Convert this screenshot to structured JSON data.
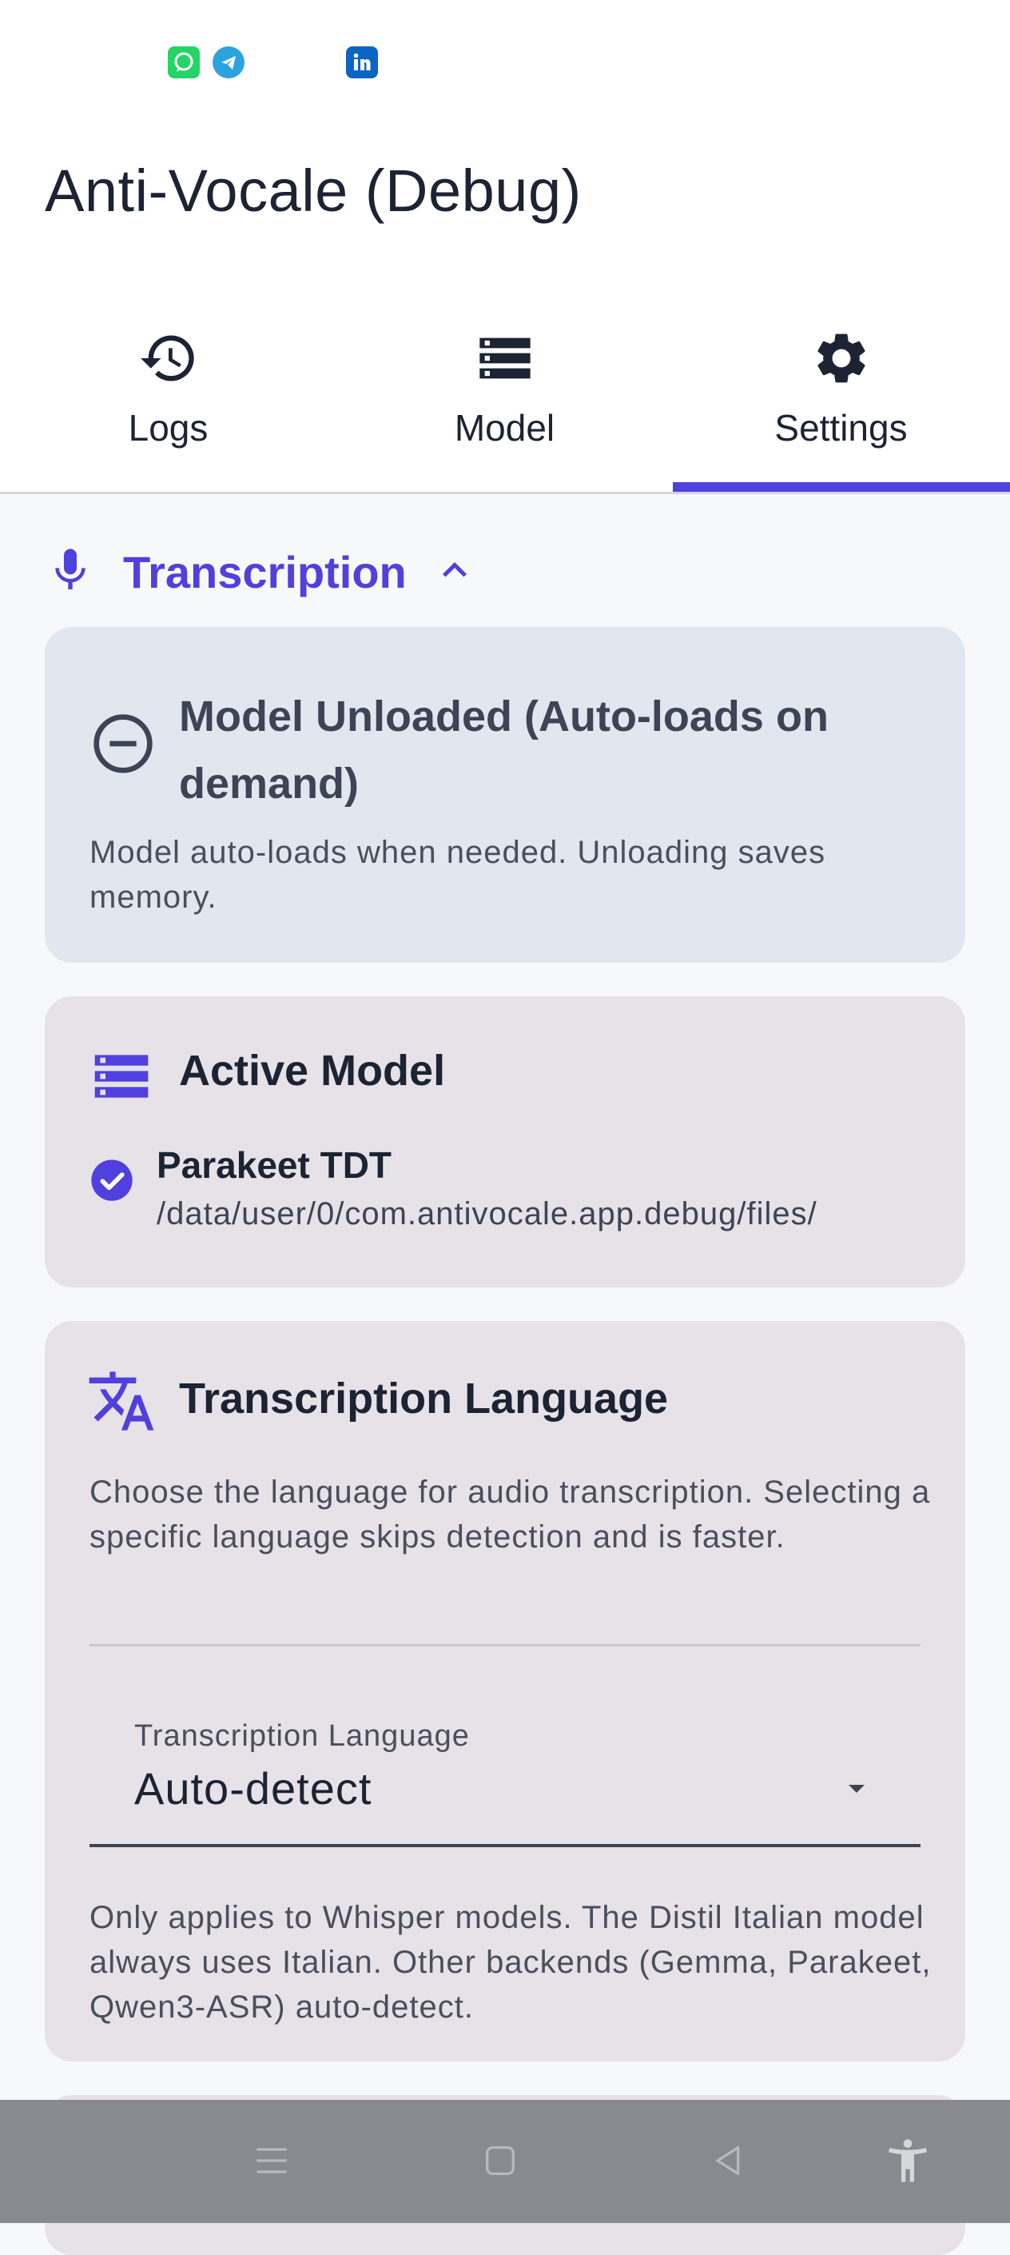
{
  "app": {
    "title": "Anti-Vocale (Debug)"
  },
  "status_bar": {
    "notification_icons": [
      "whatsapp-icon",
      "telegram-icon",
      "linkedin-icon"
    ]
  },
  "tabs": [
    {
      "label": "Logs",
      "icon": "history-icon",
      "selected": false
    },
    {
      "label": "Model",
      "icon": "storage-icon",
      "selected": false
    },
    {
      "label": "Settings",
      "icon": "gear-icon",
      "selected": true
    }
  ],
  "section": {
    "title": "Transcription",
    "icon": "microphone-icon",
    "expanded": true
  },
  "cards": {
    "model_status": {
      "title": "Model Unloaded (Auto-loads on demand)",
      "title_line1": "Model Unloaded (Auto-loads on",
      "title_line2": "demand)",
      "description": "Model auto-loads when needed. Unloading saves memory."
    },
    "active_model": {
      "title": "Active Model",
      "name": "Parakeet TDT",
      "path": "/data/user/0/com.antivocale.app.debug/files/"
    },
    "transcription_language": {
      "title": "Transcription Language",
      "description": "Choose the language for audio transcription. Selecting a specific language skips detection and is faster.",
      "dropdown_label": "Transcription Language",
      "dropdown_value": "Auto-detect",
      "note": "Only applies to Whisper models. The Distil Italian model always uses Italian. Other backends (Gemma, Parakeet, Qwen3-ASR) auto-detect."
    }
  },
  "nav_bar": {
    "buttons": [
      "menu-icon",
      "home-icon",
      "back-icon",
      "accessibility-icon"
    ]
  },
  "colors": {
    "accent": "#5040dd",
    "status_card_bg": "#e1e7ef",
    "card_bg": "#e7e2e8",
    "text_primary": "#1c2333",
    "text_secondary": "#4a4f5c",
    "whatsapp": "#25d366",
    "telegram": "#2aa3e0",
    "linkedin": "#0a66c2"
  }
}
